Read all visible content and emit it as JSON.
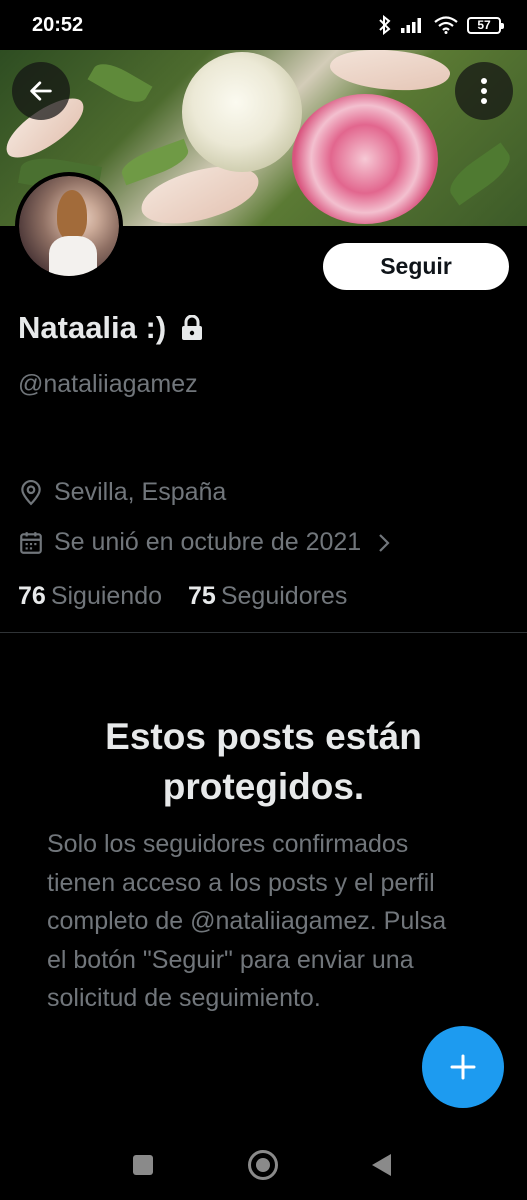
{
  "status_bar": {
    "time": "20:52",
    "battery": "57"
  },
  "profile": {
    "display_name": "Nataalia :)",
    "handle": "@nataliiagamez",
    "location": "Sevilla, España",
    "joined": "Se unió en octubre de 2021",
    "following_count": "76",
    "following_label": "Siguiendo",
    "followers_count": "75",
    "followers_label": "Seguidores"
  },
  "actions": {
    "follow_label": "Seguir"
  },
  "protected": {
    "title": "Estos posts están protegidos.",
    "body": "Solo los seguidores confirmados tienen acceso a los posts y el perfil completo de @nataliiagamez. Pulsa el botón \"Seguir\" para enviar una solicitud de seguimiento."
  },
  "icons": {
    "back": "arrow-left-icon",
    "more": "more-vertical-icon",
    "lock": "lock-icon",
    "location": "location-pin-icon",
    "calendar": "calendar-icon",
    "chevron": "chevron-right-icon",
    "compose": "plus-icon"
  },
  "colors": {
    "background": "#000000",
    "primary_text": "#e7e9ea",
    "secondary_text": "#71767b",
    "accent": "#1d9bf0",
    "follow_button_bg": "#ffffff"
  }
}
